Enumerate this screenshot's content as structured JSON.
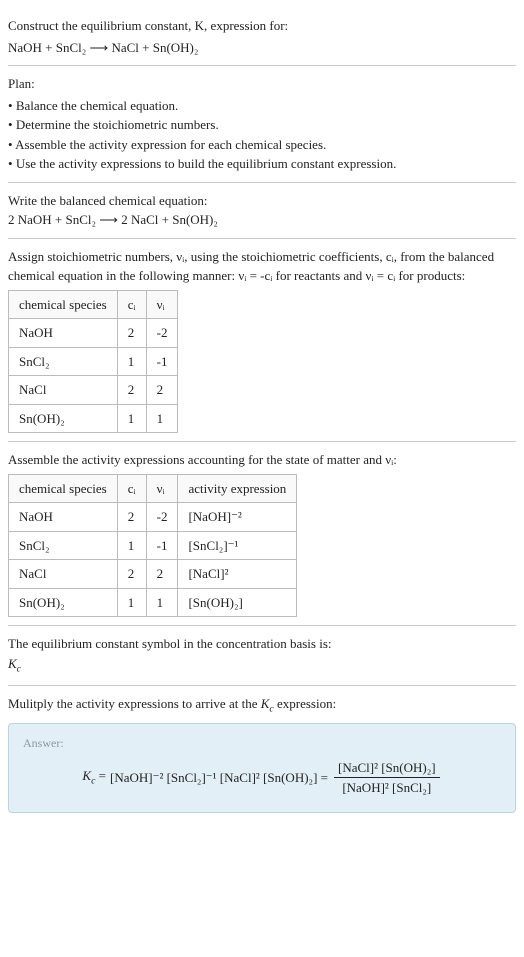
{
  "header": {
    "prompt": "Construct the equilibrium constant, K, expression for:",
    "reaction_unbalanced": "NaOH + SnCl₂ ⟶ NaCl + Sn(OH)₂"
  },
  "plan": {
    "title": "Plan:",
    "items": [
      "Balance the chemical equation.",
      "Determine the stoichiometric numbers.",
      "Assemble the activity expression for each chemical species.",
      "Use the activity expressions to build the equilibrium constant expression."
    ]
  },
  "balanced": {
    "title": "Write the balanced chemical equation:",
    "equation": "2 NaOH + SnCl₂ ⟶ 2 NaCl + Sn(OH)₂"
  },
  "stoich": {
    "intro": "Assign stoichiometric numbers, νᵢ, using the stoichiometric coefficients, cᵢ, from the balanced chemical equation in the following manner: νᵢ = -cᵢ for reactants and νᵢ = cᵢ for products:",
    "headers": [
      "chemical species",
      "cᵢ",
      "νᵢ"
    ],
    "rows": [
      {
        "species": "NaOH",
        "ci": "2",
        "vi": "-2"
      },
      {
        "species": "SnCl₂",
        "ci": "1",
        "vi": "-1"
      },
      {
        "species": "NaCl",
        "ci": "2",
        "vi": "2"
      },
      {
        "species": "Sn(OH)₂",
        "ci": "1",
        "vi": "1"
      }
    ]
  },
  "activity": {
    "intro": "Assemble the activity expressions accounting for the state of matter and νᵢ:",
    "headers": [
      "chemical species",
      "cᵢ",
      "νᵢ",
      "activity expression"
    ],
    "rows": [
      {
        "species": "NaOH",
        "ci": "2",
        "vi": "-2",
        "expr": "[NaOH]⁻²"
      },
      {
        "species": "SnCl₂",
        "ci": "1",
        "vi": "-1",
        "expr": "[SnCl₂]⁻¹"
      },
      {
        "species": "NaCl",
        "ci": "2",
        "vi": "2",
        "expr": "[NaCl]²"
      },
      {
        "species": "Sn(OH)₂",
        "ci": "1",
        "vi": "1",
        "expr": "[Sn(OH)₂]"
      }
    ]
  },
  "kc_symbol": {
    "line1": "The equilibrium constant symbol in the concentration basis is:",
    "line2": "K_c"
  },
  "multiply": {
    "intro": "Mulitply the activity expressions to arrive at the K_c expression:"
  },
  "answer": {
    "label": "Answer:",
    "lhs": "K_c =",
    "flat": "[NaOH]⁻² [SnCl₂]⁻¹ [NaCl]² [Sn(OH)₂] =",
    "frac_num": "[NaCl]² [Sn(OH)₂]",
    "frac_den": "[NaOH]² [SnCl₂]"
  }
}
